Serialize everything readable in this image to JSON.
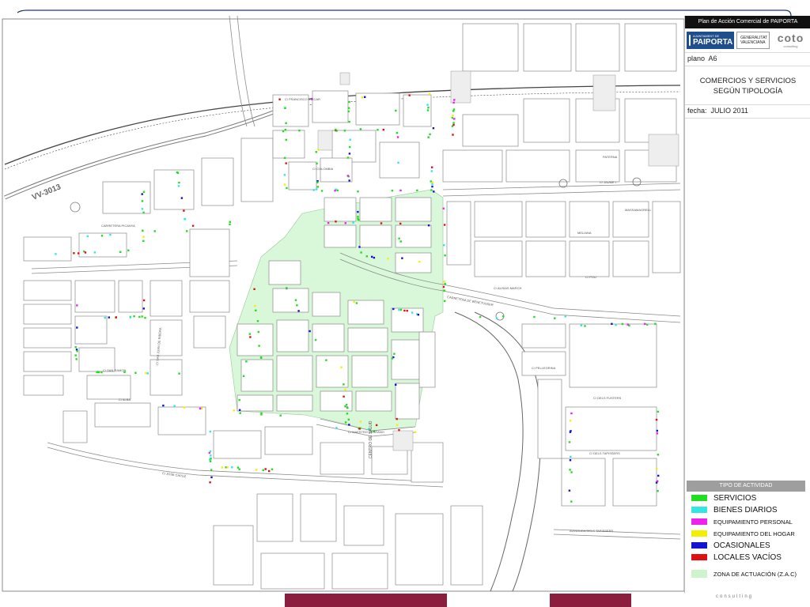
{
  "header": {
    "plan_title": "Plan de Acción Comercial de PAIPORTA",
    "logo_paiporta_small": "AJUNTAMENT DE",
    "logo_paiporta_big": "PAIPORTA",
    "logo_gv": "GENERALITAT VALENCIANA",
    "logo_coto": "coto",
    "logo_coto_sub": "consulting",
    "plano_label": "plano",
    "plano_value": "A6",
    "map_title_line1": "COMERCIOS Y SERVICIOS",
    "map_title_line2": "SEGÚN TIPOLOGÍA",
    "fecha_label": "fecha:",
    "fecha_value": "JULIO 2011"
  },
  "legend": {
    "title": "TIPO DE ACTIVIDAD",
    "items": [
      {
        "label": "SERVICIOS",
        "color": "#22dd22"
      },
      {
        "label": "BIENES DIARIOS",
        "color": "#33e5e5"
      },
      {
        "label": "EQUIPAMIENTO PERSONAL",
        "color": "#ee22ee"
      },
      {
        "label": "EQUIPAMIENTO DEL HOGAR",
        "color": "#f2f000"
      },
      {
        "label": "OCASIONALES",
        "color": "#1414d0"
      },
      {
        "label": "LOCALES VACÍOS",
        "color": "#e01010"
      }
    ],
    "zone": {
      "label": "ZONA DE ACTUACIÓN (Z.A.C)",
      "color": "#ccf5cc"
    }
  },
  "map": {
    "road_label": "VV-3013",
    "street_labels": [
      "C/ FRANCISCO CISCAR",
      "C/ JAUME I",
      "CARRETERA DE BENETUSSER",
      "CARRETERA PICANYA",
      "C/ JOSE CAPUZ",
      "C/ DELS FUSTERS",
      "C/ DELS TAPISSERS",
      "AVINGUDA DELS TAPISSERS",
      "C/ SAN JUAN DE RIBERA",
      "CENTRO DE SALUD",
      "C/ MAESTRO SERRANO",
      "C/ SAN RAMON",
      "C/ ALBA",
      "MASSAMAGRELL",
      "MELIANA",
      "C/ POU",
      "C/ PELLEGRINA",
      "C/ AUSIAS MARCH",
      "C/ COLOMBIA",
      "PATERNA"
    ]
  },
  "footer": {
    "consulting": "consulting",
    "bar_color": "#8b1e3f"
  },
  "colors": {
    "street_outline": "#8a8a8a",
    "zone_fill": "#ccf5cc",
    "rail": "#444444"
  }
}
